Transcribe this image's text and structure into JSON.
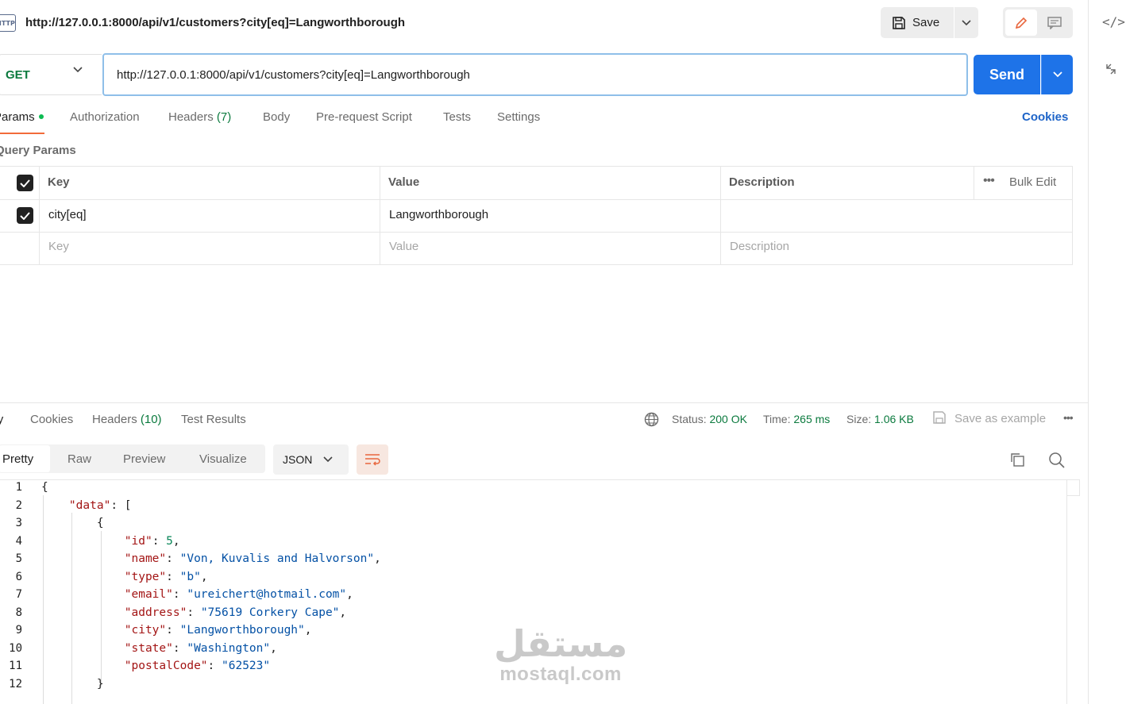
{
  "request": {
    "icon_text": "HTTP",
    "title": "http://127.0.0.1:8000/api/v1/customers?city[eq]=Langworthborough",
    "save_label": "Save",
    "method": "GET",
    "url": "http://127.0.0.1:8000/api/v1/customers?city[eq]=Langworthborough",
    "send_label": "Send"
  },
  "request_tabs": [
    {
      "label": "Params"
    },
    {
      "label": "Authorization"
    },
    {
      "label": "Headers",
      "count": "(7)"
    },
    {
      "label": "Body"
    },
    {
      "label": "Pre-request Script"
    },
    {
      "label": "Tests"
    },
    {
      "label": "Settings"
    }
  ],
  "cookies_label": "Cookies",
  "params": {
    "section_title": "Query Params",
    "headers": {
      "key": "Key",
      "value": "Value",
      "description": "Description"
    },
    "bulk_edit": "Bulk Edit",
    "rows": [
      {
        "key": "city[eq]",
        "value": "Langworthborough",
        "description": "",
        "checked": true
      }
    ],
    "placeholders": {
      "key": "Key",
      "value": "Value",
      "description": "Description"
    }
  },
  "response": {
    "tabs": [
      {
        "label": "Body"
      },
      {
        "label": "Cookies"
      },
      {
        "label": "Headers",
        "count": "(10)"
      },
      {
        "label": "Test Results"
      }
    ],
    "status_label": "Status:",
    "status_value": "200 OK",
    "time_label": "Time:",
    "time_value": "265 ms",
    "size_label": "Size:",
    "size_value": "1.06 KB",
    "save_example": "Save as example",
    "formats": [
      "Pretty",
      "Raw",
      "Preview",
      "Visualize"
    ],
    "language": "JSON",
    "lines": [
      "1",
      "2",
      "3",
      "4",
      "5",
      "6",
      "7",
      "8",
      "9",
      "10",
      "11",
      "12"
    ]
  },
  "body_json": {
    "data_key": "\"data\"",
    "fields": [
      {
        "key": "\"id\"",
        "value": "5",
        "kind": "n"
      },
      {
        "key": "\"name\"",
        "value": "\"Von, Kuvalis and Halvorson\"",
        "kind": "s"
      },
      {
        "key": "\"type\"",
        "value": "\"b\"",
        "kind": "s"
      },
      {
        "key": "\"email\"",
        "value": "\"ureichert@hotmail.com\"",
        "kind": "s"
      },
      {
        "key": "\"address\"",
        "value": "\"75619 Corkery Cape\"",
        "kind": "s"
      },
      {
        "key": "\"city\"",
        "value": "\"Langworthborough\"",
        "kind": "s"
      },
      {
        "key": "\"state\"",
        "value": "\"Washington\"",
        "kind": "s"
      },
      {
        "key": "\"postalCode\"",
        "value": "\"62523\"",
        "kind": "s"
      }
    ]
  },
  "watermark": {
    "logo": "مستقل",
    "text": "mostaql.com"
  },
  "colors": {
    "accent": "#1e73e8",
    "tab_underline": "#f26b3a",
    "status_green": "#0b7a3e"
  }
}
